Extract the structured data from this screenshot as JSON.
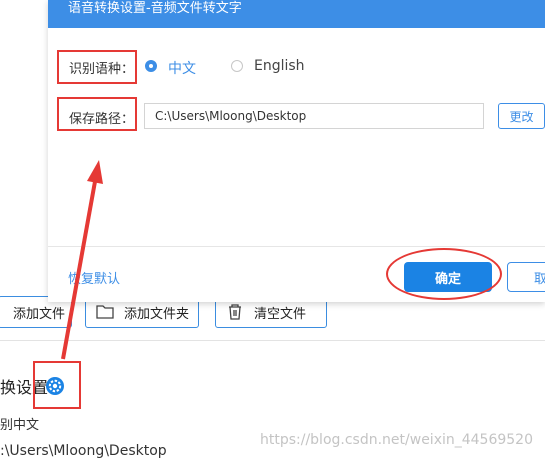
{
  "dialog": {
    "title": "语音转换设置-音频文件转文字",
    "language_label": "识别语种：",
    "lang_option_cn": "中文",
    "lang_option_en": "English",
    "selected_language": "中文",
    "path_label": "保存路径：",
    "path_value": "C:\\Users\\Mloong\\Desktop",
    "change_button": "更改",
    "restore_default": "恢复默认",
    "confirm_button": "确定",
    "cancel_button": "取"
  },
  "background": {
    "toolbar": {
      "add_file": "添加文件",
      "add_folder": "添加文件夹",
      "clear_files": "清空文件"
    },
    "settings_title": "换设置",
    "recognized_language": "别中文",
    "output_path": ":\\Users\\Mloong\\Desktop"
  },
  "watermark": "https://blog.csdn.net/weixin_44569520",
  "colors": {
    "accent": "#3d8ee6",
    "confirm": "#1b83e4",
    "annotation": "#e53935"
  }
}
